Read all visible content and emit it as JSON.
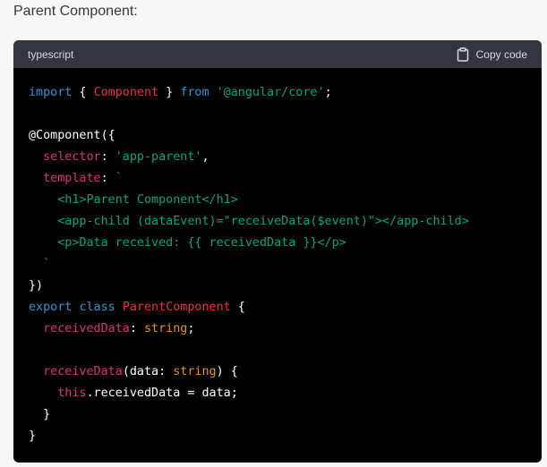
{
  "heading": "Parent Component:",
  "code_block": {
    "language": "typescript",
    "copy_label": "Copy code",
    "lines": [
      [
        {
          "t": "import",
          "c": "keyword"
        },
        {
          "t": " { ",
          "c": "plain"
        },
        {
          "t": "Component",
          "c": "title"
        },
        {
          "t": " } ",
          "c": "plain"
        },
        {
          "t": "from",
          "c": "keyword"
        },
        {
          "t": " ",
          "c": "plain"
        },
        {
          "t": "'@angular/core'",
          "c": "string"
        },
        {
          "t": ";",
          "c": "plain"
        }
      ],
      [],
      [
        {
          "t": "@Component",
          "c": "plain"
        },
        {
          "t": "({",
          "c": "plain"
        }
      ],
      [
        {
          "t": "  ",
          "c": "plain"
        },
        {
          "t": "selector",
          "c": "prop"
        },
        {
          "t": ": ",
          "c": "plain"
        },
        {
          "t": "'app-parent'",
          "c": "string"
        },
        {
          "t": ",",
          "c": "plain"
        }
      ],
      [
        {
          "t": "  ",
          "c": "plain"
        },
        {
          "t": "template",
          "c": "prop"
        },
        {
          "t": ": ",
          "c": "plain"
        },
        {
          "t": "`",
          "c": "string"
        }
      ],
      [
        {
          "t": "    <h1>Parent Component</h1>",
          "c": "string"
        }
      ],
      [
        {
          "t": "    <app-child (dataEvent)=\"receiveData($event)\"></app-child>",
          "c": "string"
        }
      ],
      [
        {
          "t": "    <p>Data received: {{ receivedData }}</p>",
          "c": "string"
        }
      ],
      [
        {
          "t": "  `",
          "c": "string"
        }
      ],
      [
        {
          "t": "})",
          "c": "plain"
        }
      ],
      [
        {
          "t": "export",
          "c": "keyword"
        },
        {
          "t": " ",
          "c": "plain"
        },
        {
          "t": "class",
          "c": "keyword"
        },
        {
          "t": " ",
          "c": "plain"
        },
        {
          "t": "ParentComponent",
          "c": "title"
        },
        {
          "t": " {",
          "c": "plain"
        }
      ],
      [
        {
          "t": "  ",
          "c": "plain"
        },
        {
          "t": "receivedData",
          "c": "prop"
        },
        {
          "t": ": ",
          "c": "plain"
        },
        {
          "t": "string",
          "c": "builtin"
        },
        {
          "t": ";",
          "c": "plain"
        }
      ],
      [],
      [
        {
          "t": "  ",
          "c": "plain"
        },
        {
          "t": "receiveData",
          "c": "prop"
        },
        {
          "t": "(",
          "c": "plain"
        },
        {
          "t": "data",
          "c": "plain"
        },
        {
          "t": ": ",
          "c": "plain"
        },
        {
          "t": "string",
          "c": "builtin"
        },
        {
          "t": ") {",
          "c": "plain"
        }
      ],
      [
        {
          "t": "    ",
          "c": "plain"
        },
        {
          "t": "this",
          "c": "this"
        },
        {
          "t": ".receivedData = data;",
          "c": "plain"
        }
      ],
      [
        {
          "t": "  }",
          "c": "plain"
        }
      ],
      [
        {
          "t": "}",
          "c": "plain"
        }
      ]
    ]
  },
  "icons": {
    "copy": "clipboard-icon"
  },
  "colors": {
    "page_bg": "#f7f7f8",
    "code_bg": "#000000",
    "header_bg": "#343541",
    "keyword": "#2e95d3",
    "title": "#f22c3d",
    "string": "#00a67d",
    "prop": "#df3079",
    "builtin": "#e9950c"
  }
}
